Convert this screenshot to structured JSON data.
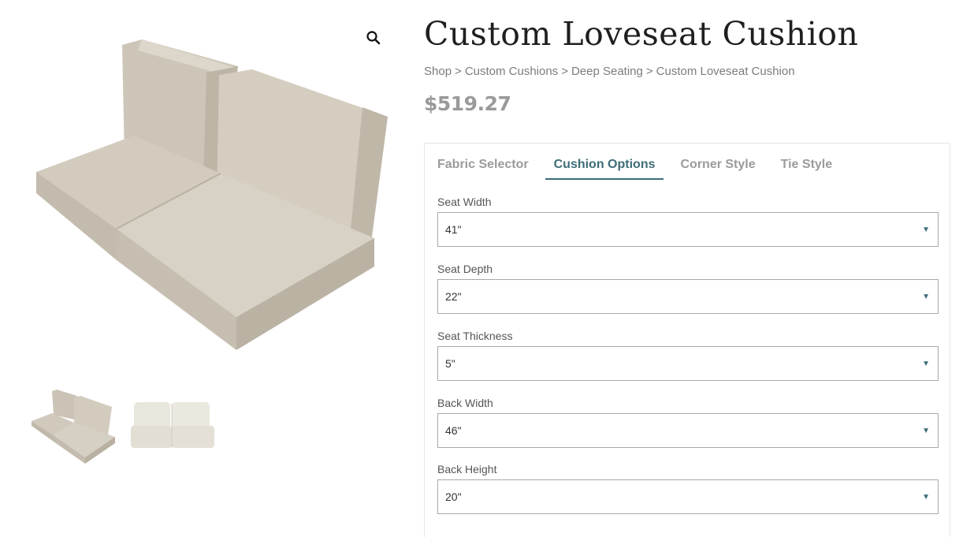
{
  "product": {
    "title": "Custom Loveseat Cushion",
    "price": "$519.27"
  },
  "breadcrumb": [
    "Shop",
    "Custom Cushions",
    "Deep Seating",
    "Custom Loveseat Cushion"
  ],
  "breadcrumb_separator": ">",
  "gallery": {
    "zoom_icon": "magnifier-icon",
    "thumbnails": [
      "loveseat-cushion-beige",
      "loveseat-cushion-white"
    ]
  },
  "tabs": [
    {
      "label": "Fabric Selector",
      "active": false
    },
    {
      "label": "Cushion Options",
      "active": true
    },
    {
      "label": "Corner Style",
      "active": false
    },
    {
      "label": "Tie Style",
      "active": false
    }
  ],
  "fields": [
    {
      "label": "Seat Width",
      "value": "41\""
    },
    {
      "label": "Seat Depth",
      "value": "22\""
    },
    {
      "label": "Seat Thickness",
      "value": "5\""
    },
    {
      "label": "Back Width",
      "value": "46\""
    },
    {
      "label": "Back Height",
      "value": "20\""
    }
  ],
  "colors": {
    "accent": "#3d6d77",
    "cushion_fabric": "#d2cbbe",
    "price": "#9a9a9a"
  }
}
